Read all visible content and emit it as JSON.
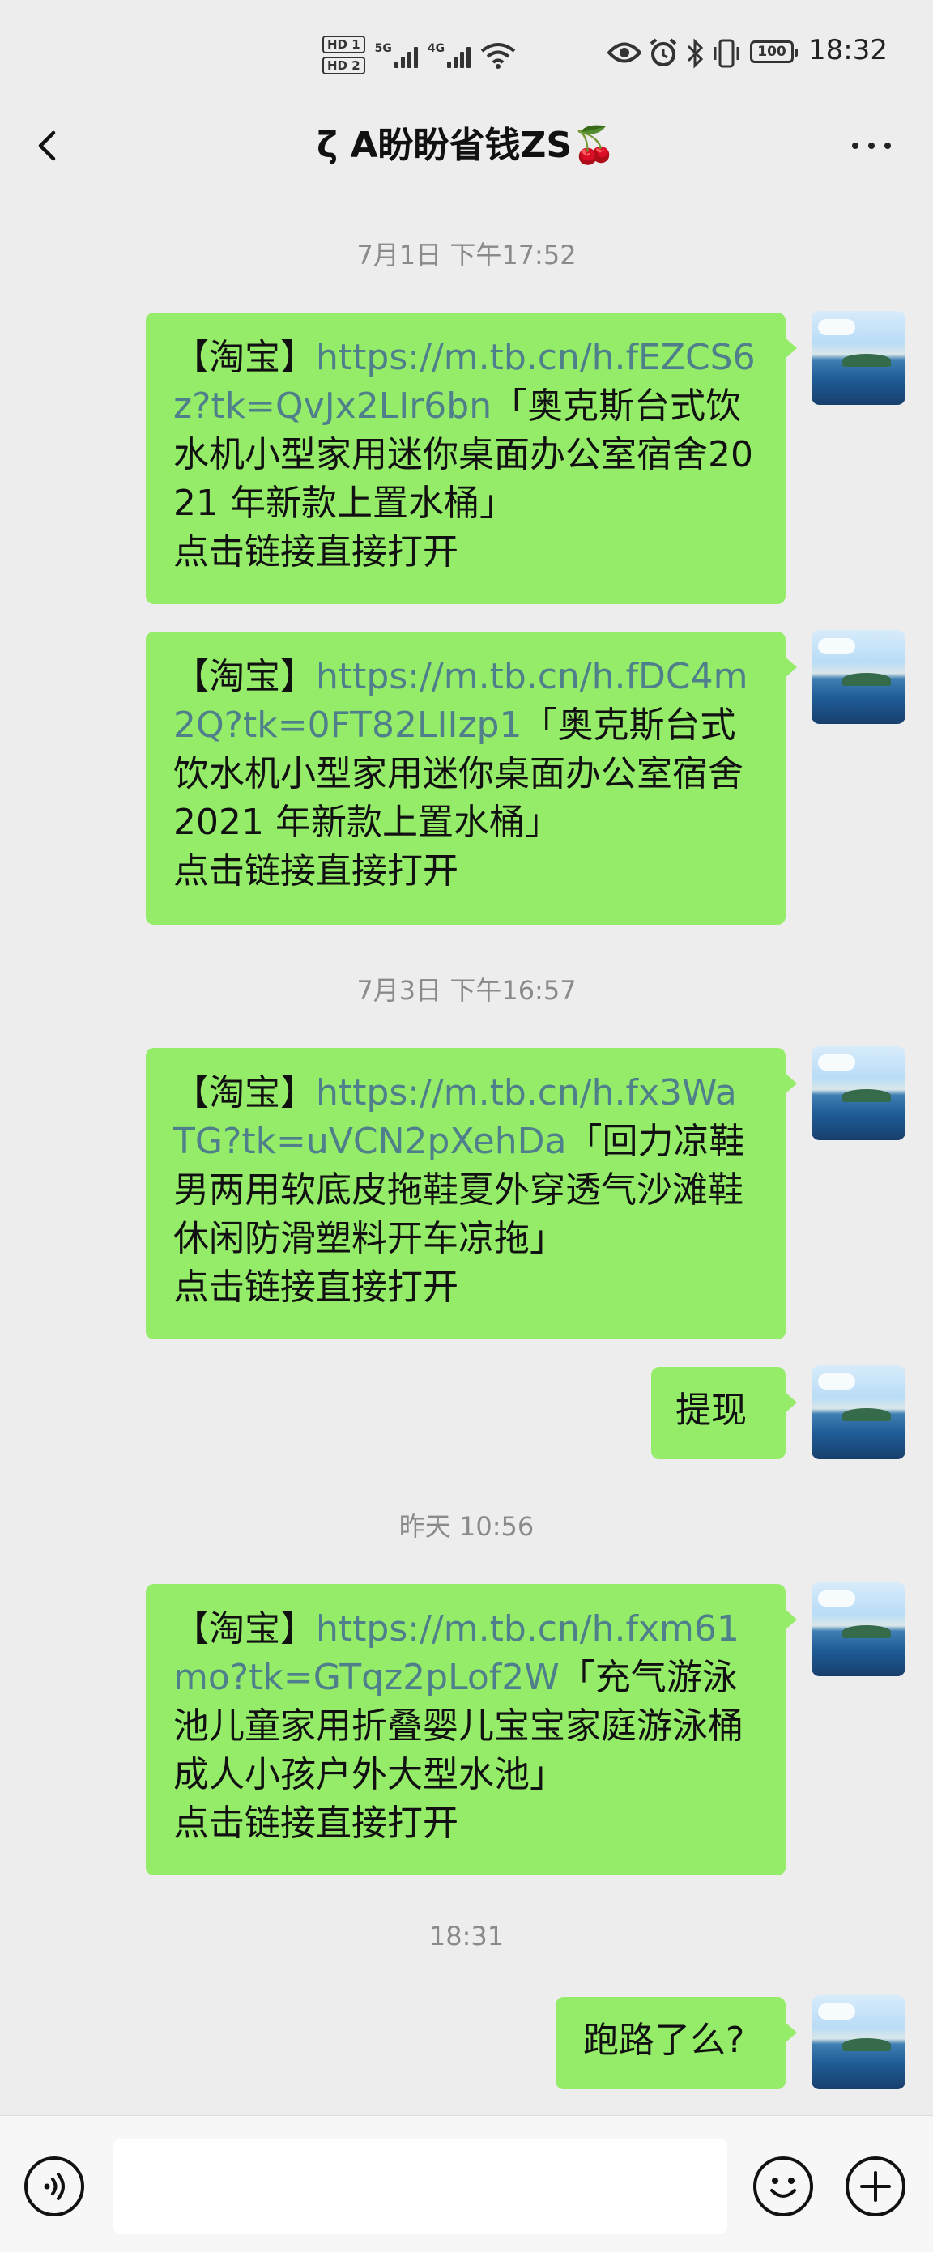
{
  "status_bar": {
    "hd1": "HD 1",
    "hd2": "HD 2",
    "sig1_label": "5G",
    "sig2_label": "4G",
    "battery": "100",
    "time": "18:32"
  },
  "header": {
    "title": "ζ A盼盼省钱ZS🍒"
  },
  "messages": {
    "ts1": "7月1日 下午17:52",
    "m1": {
      "prefix": "【淘宝】",
      "link": "https://m.tb.cn/h.fEZCS6z?tk=QvJx2LIr6bn",
      "text": "「奥克斯台式饮水机小型家用迷你桌面办公室宿舍2021 年新款上置水桶」",
      "footer": "点击链接直接打开"
    },
    "m2": {
      "prefix": "【淘宝】",
      "link": "https://m.tb.cn/h.fDC4m2Q?tk=0FT82LIIzp1",
      "text": "「奥克斯台式饮水机小型家用迷你桌面办公室宿舍 2021 年新款上置水桶」",
      "footer": "点击链接直接打开"
    },
    "ts2": "7月3日 下午16:57",
    "m3": {
      "prefix": "【淘宝】",
      "link": "https://m.tb.cn/h.fx3WaTG?tk=uVCN2pXehDa",
      "text": "「回力凉鞋男两用软底皮拖鞋夏外穿透气沙滩鞋休闲防滑塑料开车凉拖」",
      "footer": "点击链接直接打开"
    },
    "m4": {
      "text": "提现"
    },
    "ts3": "昨天 10:56",
    "m5": {
      "prefix": "【淘宝】",
      "link": "https://m.tb.cn/h.fxm61mo?tk=GTqz2pLof2W",
      "text": "「充气游泳池儿童家用折叠婴儿宝宝家庭游泳桶成人小孩户外大型水池」",
      "footer": "点击链接直接打开"
    },
    "ts4": "18:31",
    "m6": {
      "text": "跑路了么?"
    }
  },
  "icons": {
    "back": "chevron-left-icon",
    "more": "more-dots-icon",
    "voice": "voice-icon",
    "emoji": "emoji-icon",
    "plus": "plus-icon",
    "eye": "eye-icon",
    "alarm": "alarm-icon",
    "bluetooth": "bluetooth-icon",
    "vibrate": "vibrate-icon",
    "wifi": "wifi-icon"
  },
  "colors": {
    "bubble": "#95ec69",
    "link": "#4f7f8a",
    "background": "#ededed"
  }
}
